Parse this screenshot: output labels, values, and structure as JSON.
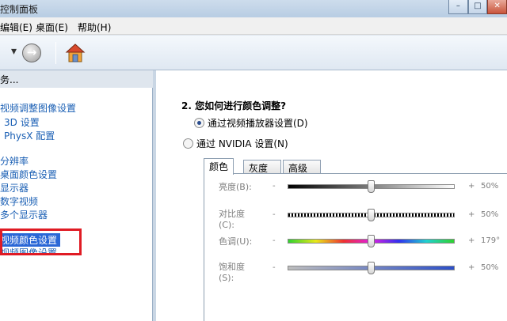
{
  "window": {
    "title": "控制面板",
    "controls": [
      "–",
      "□",
      "✕"
    ]
  },
  "menu": {
    "items": [
      "编辑(E)",
      "桌面(E)",
      "帮助(H)"
    ]
  },
  "toolbar": {
    "back_arrow": "▾",
    "forward_glyph": "→",
    "icons": [
      "forward-icon",
      "home-icon"
    ]
  },
  "sidebar": {
    "header": "务...",
    "items": [
      "调整视频调整图像设置",
      "3D 设置",
      "PhysX 配置",
      "更改分辨率",
      "调整桌面颜色设置",
      "旋转显示器",
      "调整数字视频",
      "设置多个显示器",
      "调整视频颜色设置",
      "调整视频图像设置"
    ],
    "selected_index": 8
  },
  "main": {
    "question": "2. 您如何进行颜色调整?",
    "radio_options": [
      {
        "label": "通过视频播放器设置(D)",
        "checked": true
      },
      {
        "label": "通过 NVIDIA 设置(N)",
        "checked": false
      }
    ],
    "tabs": [
      "颜色",
      "灰度",
      "高级"
    ],
    "active_tab": 0,
    "sliders": [
      {
        "label": "亮度(B):",
        "minus": "-",
        "plus": "+",
        "value": "50%",
        "level": 0.5
      },
      {
        "label_line1": "对比度",
        "label_line2": "(C):",
        "minus": "-",
        "plus": "+",
        "value": "50%",
        "level": 0.5
      },
      {
        "label": "色调(U):",
        "minus": "-",
        "plus": "+",
        "value": "179°",
        "level": 0.5
      },
      {
        "label_line1": "饱和度",
        "label_line2": "(S):",
        "minus": "-",
        "plus": "+",
        "value": "50%",
        "level": 0.5
      }
    ]
  },
  "colors": {
    "selected_bg": "#2a67d6",
    "link": "#1a5fb4",
    "highlight_box": "#e01b24"
  }
}
